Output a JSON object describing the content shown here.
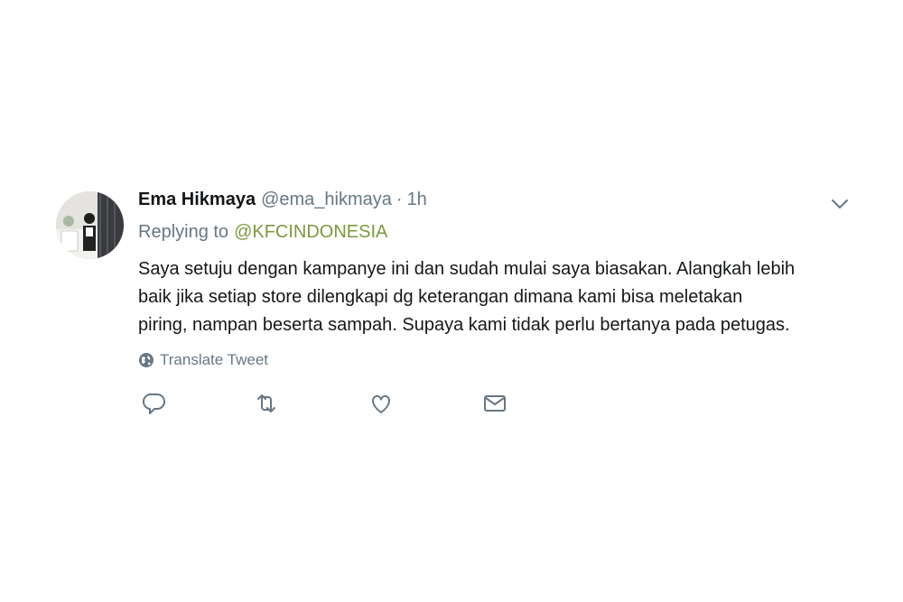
{
  "tweet": {
    "author_name": "Ema Hikmaya",
    "author_handle": "@ema_hikmaya",
    "separator": "·",
    "time_ago": "1h",
    "replying_prefix": "Replying to",
    "replying_mention": "@KFCINDONESIA",
    "text_lines": [
      "Saya setuju dengan kampanye ini dan sudah mulai saya biasakan. Alangkah lebih",
      "baik jika setiap store dilengkapi dg keterangan dimana kami bisa meletakan",
      "piring, nampan beserta sampah. Supaya kami tidak perlu bertanya pada petugas."
    ],
    "translate_label": "Translate Tweet"
  },
  "icons": {
    "caret": "chevron-down-icon",
    "translate": "globe-icon",
    "reply": "reply-icon",
    "retweet": "retweet-icon",
    "like": "heart-icon",
    "message": "envelope-icon"
  },
  "colors": {
    "text": "#14171a",
    "secondary": "#657786",
    "mention": "#7a9a3c"
  }
}
